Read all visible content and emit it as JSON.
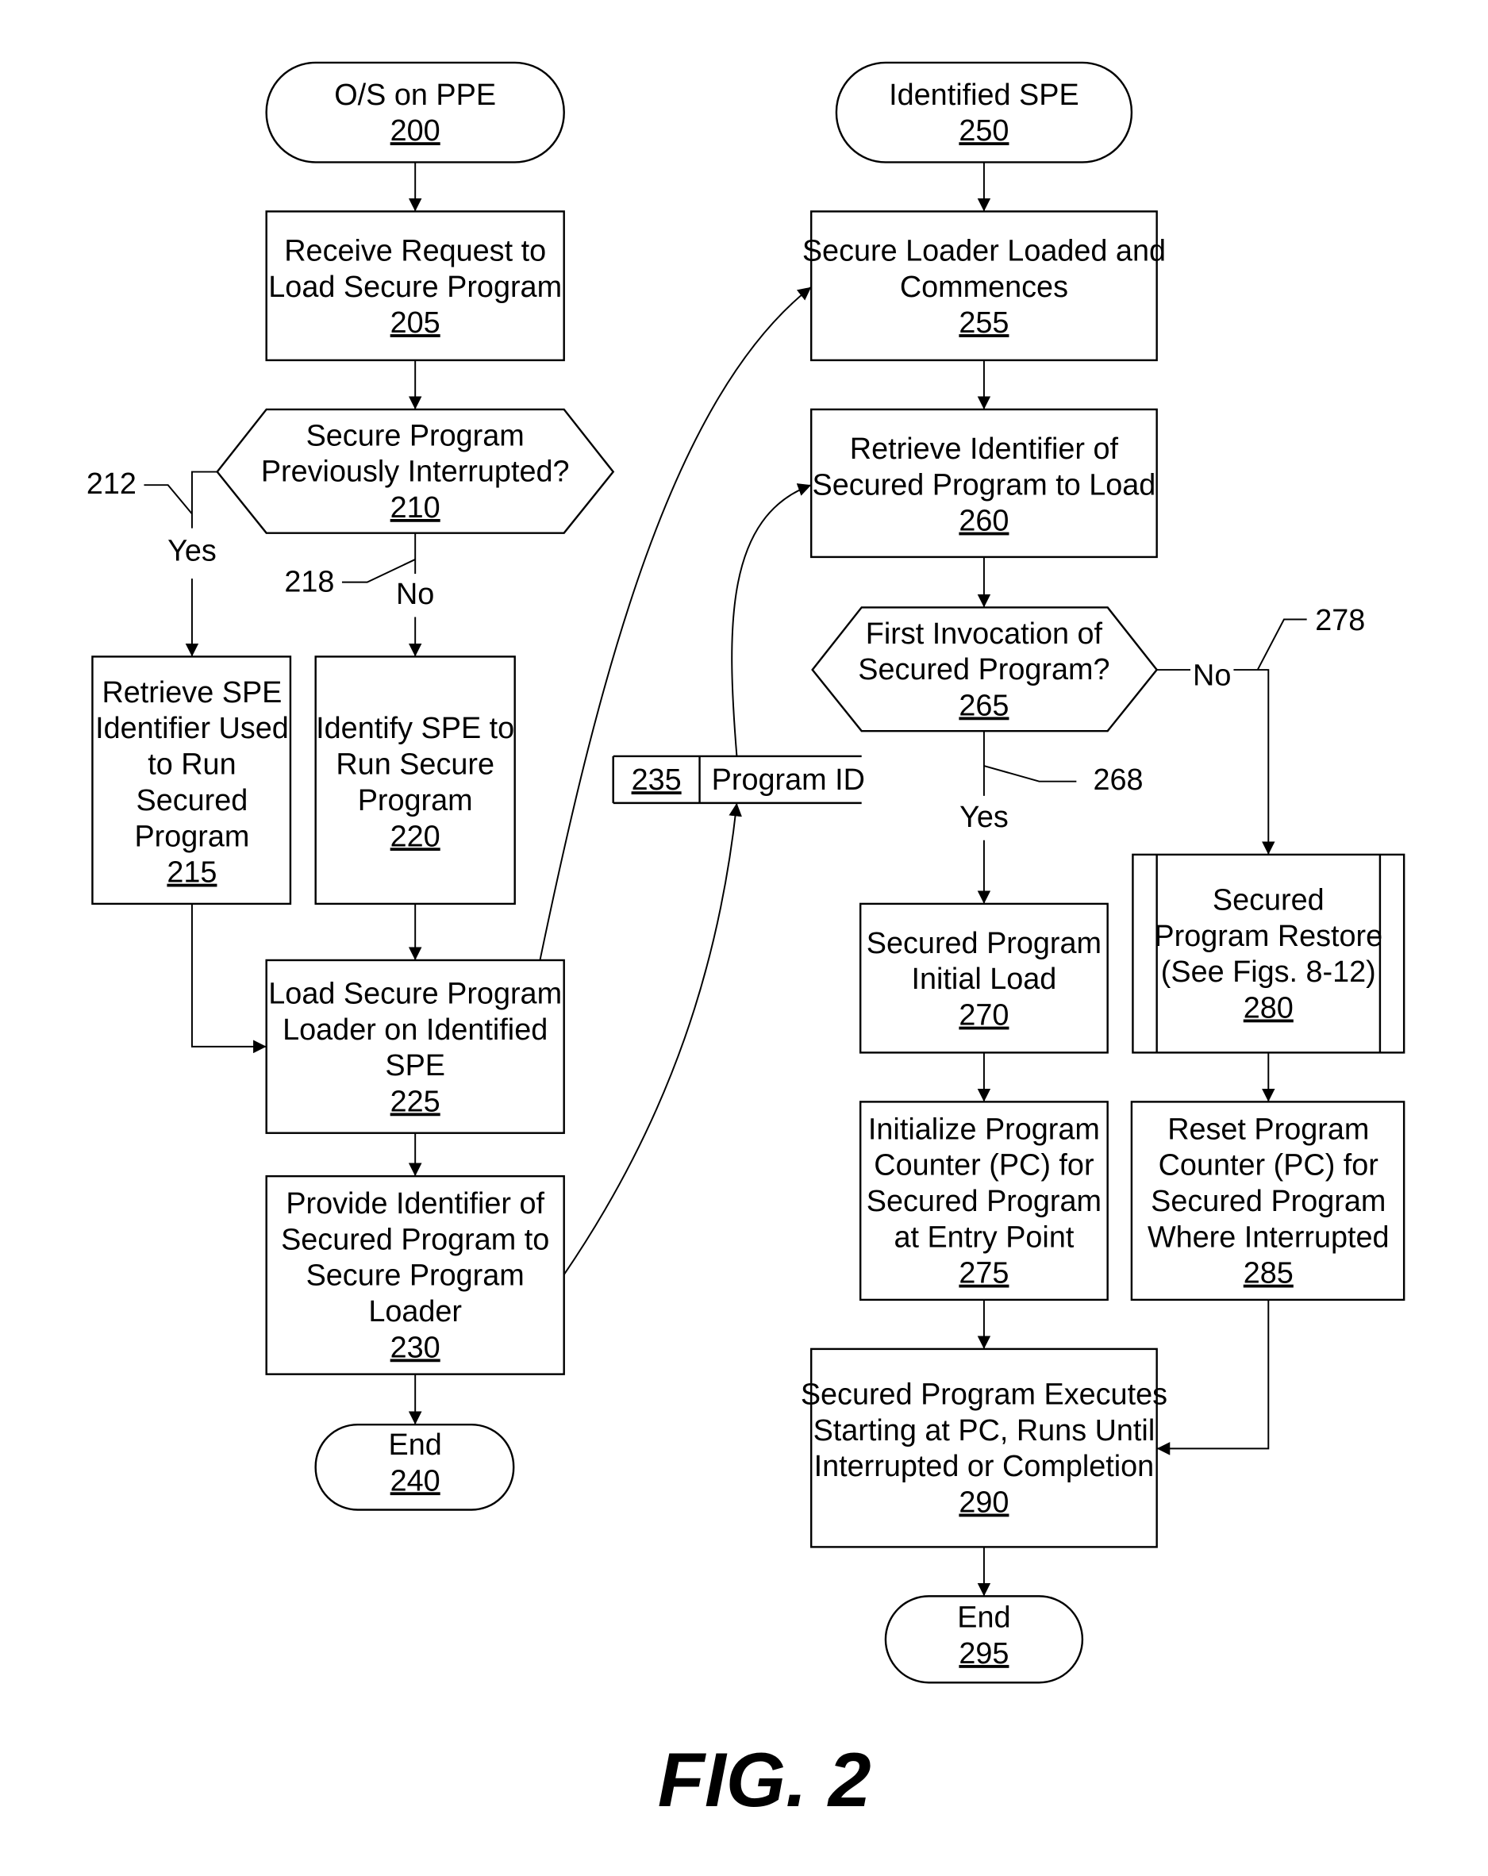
{
  "figure_label": "FIG. 2",
  "colors": {
    "ink": "#000000",
    "paper": "#ffffff"
  },
  "nodes": {
    "n200": {
      "lines": [
        "O/S on PPE"
      ],
      "ref": "200",
      "kind": "terminal"
    },
    "n205": {
      "lines": [
        "Receive Request to",
        "Load Secure Program"
      ],
      "ref": "205",
      "kind": "process"
    },
    "n210": {
      "lines": [
        "Secure Program",
        "Previously Interrupted?"
      ],
      "ref": "210",
      "kind": "decision"
    },
    "n215": {
      "lines": [
        "Retrieve SPE",
        "Identifier Used",
        "to Run",
        "Secured",
        "Program"
      ],
      "ref": "215",
      "kind": "process"
    },
    "n220": {
      "lines": [
        "Identify SPE to",
        "Run Secure",
        "Program"
      ],
      "ref": "220",
      "kind": "process"
    },
    "n225": {
      "lines": [
        "Load Secure Program",
        "Loader on Identified",
        "SPE"
      ],
      "ref": "225",
      "kind": "process"
    },
    "n230": {
      "lines": [
        "Provide Identifier of",
        "Secured Program to",
        "Secure Program",
        "Loader"
      ],
      "ref": "230",
      "kind": "process"
    },
    "n240": {
      "lines": [
        "End"
      ],
      "ref": "240",
      "kind": "terminal"
    },
    "n235": {
      "ref": "235",
      "label": "Program ID",
      "kind": "data-store"
    },
    "n250": {
      "lines": [
        "Identified SPE"
      ],
      "ref": "250",
      "kind": "terminal"
    },
    "n255": {
      "lines": [
        "Secure Loader Loaded and",
        "Commences"
      ],
      "ref": "255",
      "kind": "process"
    },
    "n260": {
      "lines": [
        "Retrieve Identifier of",
        "Secured Program to Load"
      ],
      "ref": "260",
      "kind": "process"
    },
    "n265": {
      "lines": [
        "First Invocation of",
        "Secured Program?"
      ],
      "ref": "265",
      "kind": "decision"
    },
    "n270": {
      "lines": [
        "Secured Program",
        "Initial Load"
      ],
      "ref": "270",
      "kind": "process"
    },
    "n275": {
      "lines": [
        "Initialize Program",
        "Counter (PC) for",
        "Secured Program",
        "at Entry Point"
      ],
      "ref": "275",
      "kind": "process"
    },
    "n280": {
      "lines": [
        "Secured",
        "Program Restore",
        "(See Figs. 8-12)"
      ],
      "ref": "280",
      "kind": "predefined-process"
    },
    "n285": {
      "lines": [
        "Reset Program",
        "Counter (PC) for",
        "Secured Program",
        "Where Interrupted"
      ],
      "ref": "285",
      "kind": "process"
    },
    "n290": {
      "lines": [
        "Secured Program Executes",
        "Starting at PC, Runs Until",
        "Interrupted or Completion"
      ],
      "ref": "290",
      "kind": "process"
    },
    "n295": {
      "lines": [
        "End"
      ],
      "ref": "295",
      "kind": "terminal"
    }
  },
  "branch_labels": {
    "yes_210": "Yes",
    "no_210": "No",
    "yes_265": "Yes",
    "no_265": "No"
  },
  "callouts": {
    "c212": "212",
    "c218": "218",
    "c268": "268",
    "c278": "278"
  }
}
